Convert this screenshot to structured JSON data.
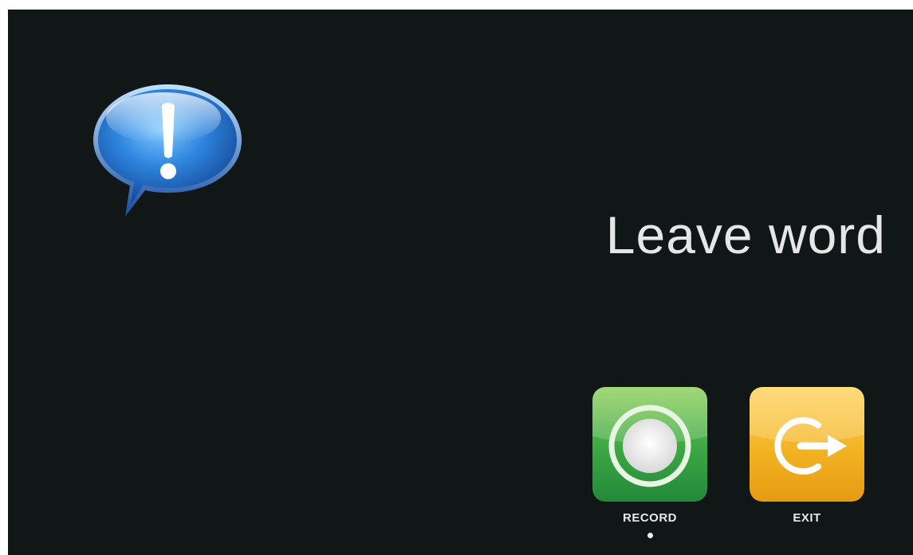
{
  "screen": {
    "title": "Leave word",
    "alert_icon": "speech-bubble-exclamation-icon",
    "actions": [
      {
        "id": "record",
        "label": "RECORD",
        "icon": "record-icon",
        "selected": true,
        "color": "#2e9a3e"
      },
      {
        "id": "exit",
        "label": "EXIT",
        "icon": "exit-arrow-icon",
        "selected": false,
        "color": "#f0b21e"
      }
    ]
  },
  "colors": {
    "background": "#111617",
    "text": "#e6e6e6",
    "record_green": "#2e9a3e",
    "exit_orange": "#f0b21e",
    "bubble_blue": "#2a74c9"
  }
}
